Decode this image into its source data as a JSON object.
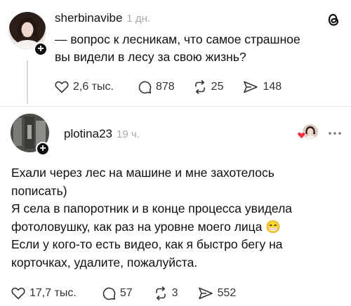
{
  "post": {
    "username": "sherbinavibe",
    "time": "1 дн.",
    "text_line1": "— вопрос к лесникам, что самое страшное",
    "text_line2": "вы видели в лесу за свою жизнь?",
    "likes": "2,6 тыс.",
    "replies": "878",
    "reposts": "25",
    "shares": "148",
    "brand_icon": "threads-logo-icon"
  },
  "reply": {
    "username": "plotina23",
    "time": "19 ч.",
    "lines": [
      "Ехали через лес на машине и мне захотелось",
      "пописать)",
      "Я села в папоротник и в конце процесса увидела",
      "фотоловушку, как раз на уровне моего лица 😁",
      "Если у кого-то есть видео, как я быстро бегу на",
      "корточках, удалите, пожалуйста."
    ],
    "likes": "17,7 тыс.",
    "replies": "57",
    "reposts": "3",
    "shares": "552",
    "more_icon": "more-dots-icon"
  },
  "colors": {
    "text": "#101010",
    "muted": "#a8a8a8",
    "heart_red": "#ff3040"
  }
}
